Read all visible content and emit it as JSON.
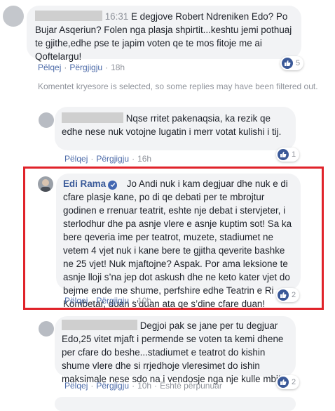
{
  "comments": [
    {
      "time": "16:31",
      "text": "E degjove Robert Ndreniken Edo? Po Bujar Asqeriun? Folen nga plasja shpirtit...keshtu jemi pothuaj te gjithe,edhe pse te japim voten qe te mos fitoje me ai Qoftelargu!",
      "reactions": "5",
      "actions": {
        "reply": "Pëlqej",
        "like": "Përgjigju",
        "age": "18h"
      }
    }
  ],
  "filter_note": "Komentet kryesore is selected, so some replies may have been filtered out.",
  "replies": [
    {
      "text": "Nqse rritet pakenaqsia, ka rezik qe edhe nese nuk votojne lugatin i merr votat kulishi i tij.",
      "reactions": "1",
      "actions": {
        "like": "Pëlqej",
        "reply": "Përgjigju",
        "age": "16h"
      }
    },
    {
      "author": "Edi Rama",
      "text": "Jo Andi nuk i kam degjuar dhe nuk e di cfare plasje kane, po di qe debati per te mbrojtur godinen e rrenuar teatrit, eshte nje debat i stervjeter, i sterlodhur dhe pa asnje vlere e asnje kuptim sot! Sa ka bere qeveria ime per teatrot, muzete, stadiumet ne vetem 4 vjet nuk i kane bere te gjitha qeverite bashke ne 25 vjet! Nuk mjaftojne? Aspak. Por ama leksione te asnje lloji s’na jep dot askush dhe ne keto kater vjet do bejme ende me shume, perfshire edhe Teatrin e Ri Kombetar, duan s’duan ata qe s’dine cfare duan!",
      "reactions": "2",
      "actions": {
        "like": "Pëlqej",
        "reply": "Përgjigju",
        "age": "10h"
      }
    },
    {
      "text": "Degjoi pak se jane per tu degjuar Edo,25 vitet mjaft i permende se voten ta kemi dhene per cfare do beshe...stadiumet e teatrot do kishin shume vlere dhe si rrjedhoje vleresimet do ishin maksimale nese sdo na i vendosje nga nje kulle mbi!",
      "reactions": "2",
      "actions": {
        "like": "Pëlqej",
        "reply": "Përgjigju",
        "age": "10h",
        "translate": "Është përpunuar"
      }
    }
  ],
  "colors": {
    "link": "#385898",
    "highlight": "#e0232a",
    "like": "#3b5998"
  },
  "icons": {
    "like": "thumbs-up-icon",
    "verified": "verified-badge-icon"
  }
}
